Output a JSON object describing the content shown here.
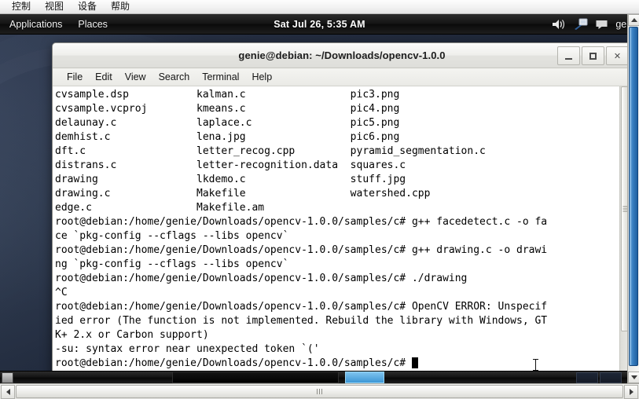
{
  "vbox": {
    "menu": [
      "控制",
      "视图",
      "设备",
      "帮助"
    ]
  },
  "panel": {
    "applications": "Applications",
    "places": "Places",
    "clock": "Sat Jul 26, 5:35 AM",
    "user": "geni",
    "icons": [
      "volume-icon",
      "display-settings-icon",
      "chat-icon"
    ]
  },
  "terminal": {
    "title": "genie@debian: ~/Downloads/opencv-1.0.0",
    "menu": [
      "File",
      "Edit",
      "View",
      "Search",
      "Terminal",
      "Help"
    ],
    "window_buttons": {
      "minimize": "minimize-button",
      "maximize": "maximize-button",
      "close": "close-button"
    },
    "lines": [
      "cvsample.dsp           kalman.c                 pic3.png",
      "cvsample.vcproj        kmeans.c                 pic4.png",
      "delaunay.c             laplace.c                pic5.png",
      "demhist.c              lena.jpg                 pic6.png",
      "dft.c                  letter_recog.cpp         pyramid_segmentation.c",
      "distrans.c             letter-recognition.data  squares.c",
      "drawing                lkdemo.c                 stuff.jpg",
      "drawing.c              Makefile                 watershed.cpp",
      "edge.c                 Makefile.am",
      "root@debian:/home/genie/Downloads/opencv-1.0.0/samples/c# g++ facedetect.c -o fa",
      "ce `pkg-config --cflags --libs opencv`",
      "root@debian:/home/genie/Downloads/opencv-1.0.0/samples/c# g++ drawing.c -o drawi",
      "ng `pkg-config --cflags --libs opencv`",
      "root@debian:/home/genie/Downloads/opencv-1.0.0/samples/c# ./drawing",
      "^C",
      "root@debian:/home/genie/Downloads/opencv-1.0.0/samples/c# OpenCV ERROR: Unspecif",
      "ied error (The function is not implemented. Rebuild the library with Windows, GT",
      "K+ 2.x or Carbon support)",
      "-su: syntax error near unexpected token `('"
    ],
    "prompt": "root@debian:/home/genie/Downloads/opencv-1.0.0/samples/c# "
  },
  "colors": {
    "terminal_bg": "#ffffff",
    "terminal_fg": "#000000",
    "panel_bg": "#101010",
    "desktop_bg": "#222b3d",
    "vbox_scroll_thumb": "#2f78b8",
    "taskbar_active": "#5aa9e0"
  }
}
